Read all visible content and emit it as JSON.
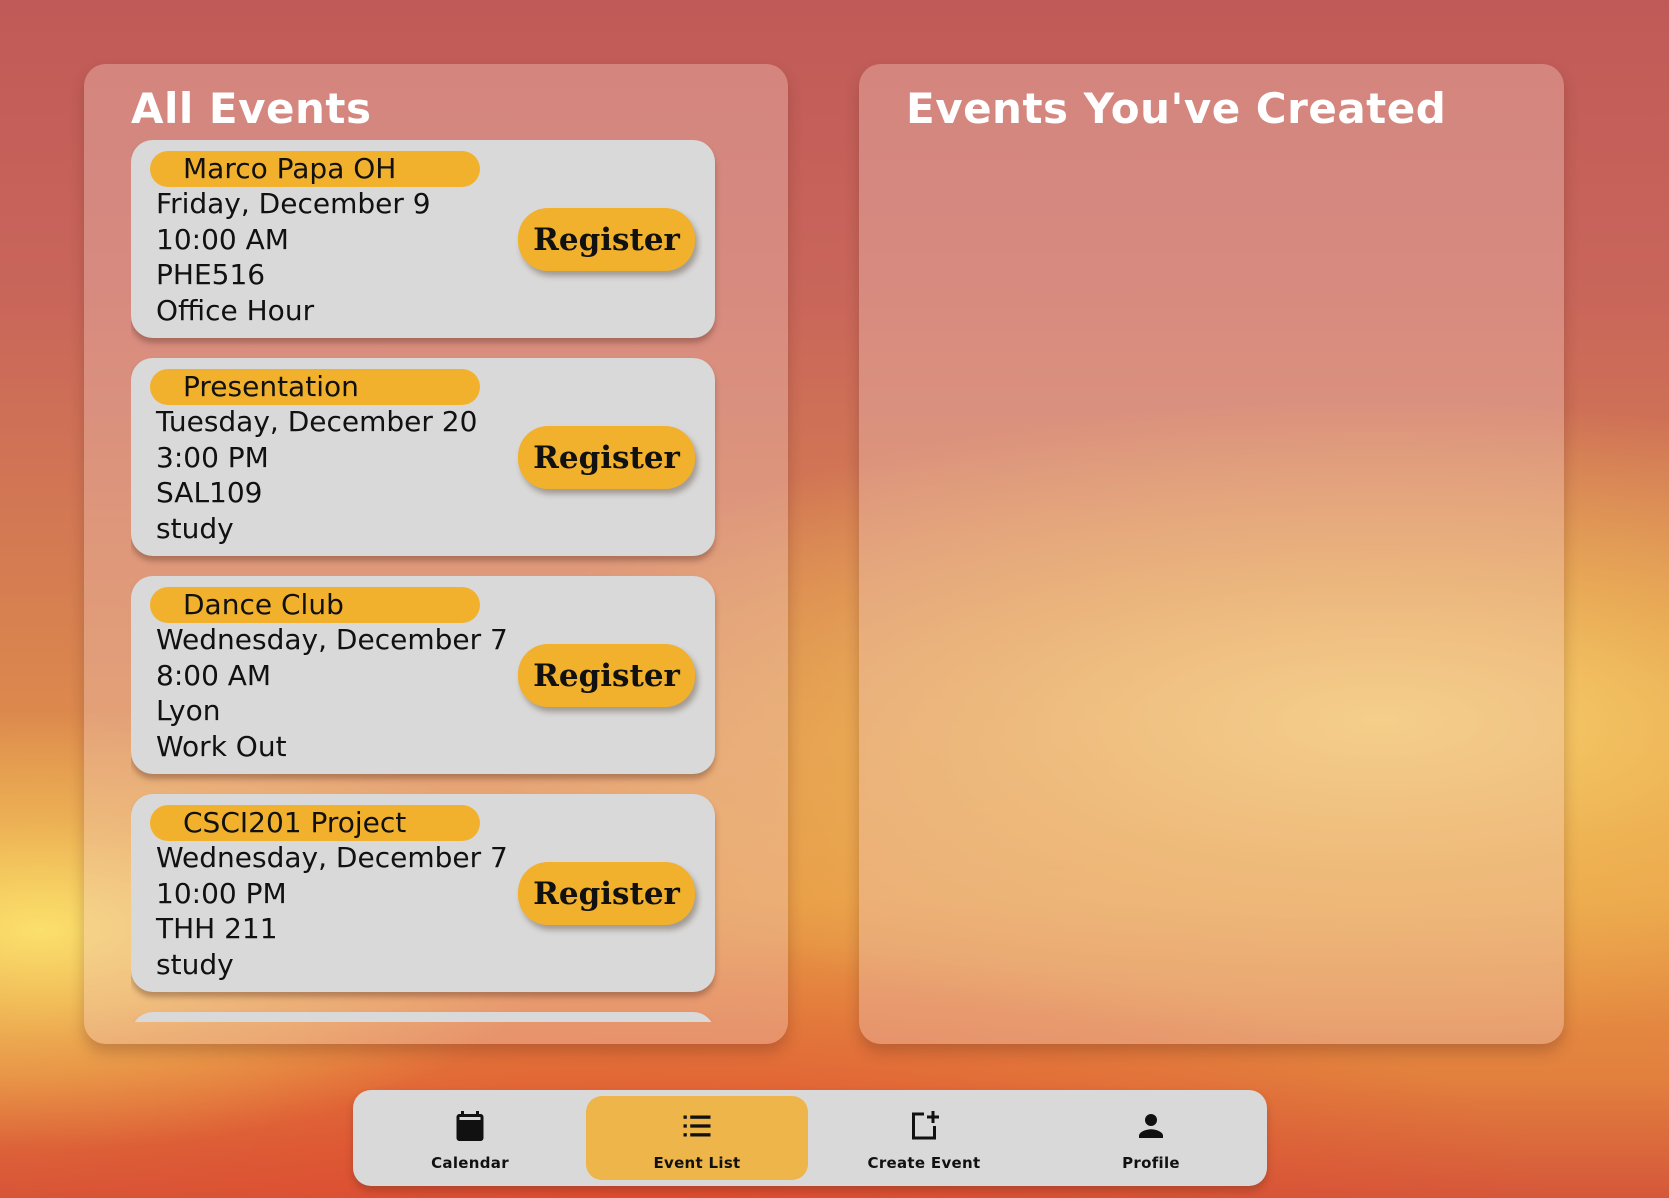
{
  "all_events": {
    "title": "All Events",
    "register_label": "Register",
    "events": [
      {
        "name": "Marco Papa OH",
        "date": "Friday, December 9",
        "time": "10:00 AM",
        "location": "PHE516",
        "category": "Office Hour"
      },
      {
        "name": "Presentation",
        "date": "Tuesday, December 20",
        "time": "3:00 PM",
        "location": "SAL109",
        "category": "study"
      },
      {
        "name": "Dance Club",
        "date": "Wednesday, December 7",
        "time": "8:00 AM",
        "location": "Lyon",
        "category": "Work Out"
      },
      {
        "name": "CSCI201 Project",
        "date": "Wednesday, December 7",
        "time": "10:00 PM",
        "location": "THH 211",
        "category": "study"
      }
    ]
  },
  "created_events": {
    "title": "Events You've Created"
  },
  "nav": {
    "items": [
      {
        "label": "Calendar",
        "icon": "calendar-icon",
        "active": false
      },
      {
        "label": "Event List",
        "icon": "list-icon",
        "active": true
      },
      {
        "label": "Create Event",
        "icon": "add-box-icon",
        "active": false
      },
      {
        "label": "Profile",
        "icon": "person-icon",
        "active": false
      }
    ],
    "active_color": "#eeb54a"
  },
  "colors": {
    "accent": "#f2b12c",
    "card": "#d9d9d9",
    "nav_bar": "#d9d9d9"
  }
}
